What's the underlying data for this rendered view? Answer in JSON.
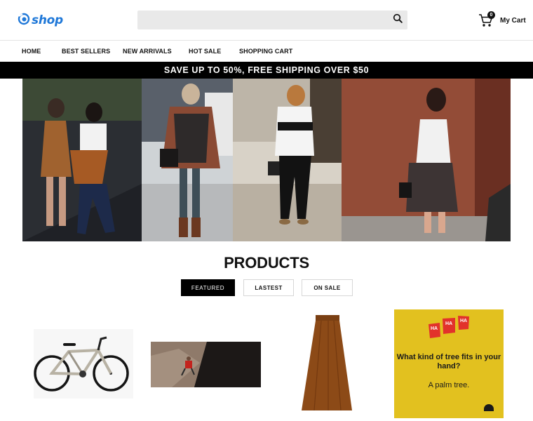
{
  "header": {
    "logo_text": "shop",
    "search": {
      "value": "",
      "placeholder": ""
    },
    "cart": {
      "count": "0",
      "label": "My Cart"
    }
  },
  "nav": {
    "items": [
      {
        "label": "HOME"
      },
      {
        "label": "BEST SELLERS"
      },
      {
        "label": "NEW ARRIVALS"
      },
      {
        "label": "HOT SALE"
      },
      {
        "label": "SHOPPING CART"
      }
    ]
  },
  "promo": {
    "text": "SAVE UP TO 50%, FREE SHIPPING OVER $50"
  },
  "products": {
    "title": "PRODUCTS",
    "tabs": [
      {
        "label": "FEATURED",
        "active": true
      },
      {
        "label": "LASTEST",
        "active": false
      },
      {
        "label": "ON SALE",
        "active": false
      }
    ],
    "joke_card": {
      "badge_text": "HA",
      "question": "What kind of tree fits in your hand?",
      "answer": "A palm tree."
    }
  },
  "colors": {
    "brand": "#1f78d8",
    "promo_bg": "#000000",
    "tab_active_bg": "#000000",
    "joke_bg": "#e2c11f",
    "joke_badge": "#e2322b"
  },
  "icons": [
    "logo-swirl-icon",
    "search-icon",
    "cart-icon"
  ]
}
